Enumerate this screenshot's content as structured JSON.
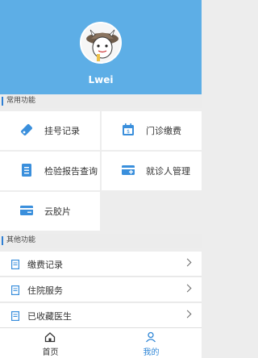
{
  "profile": {
    "username": "Lwei"
  },
  "sections": {
    "common": "常用功能",
    "other": "其他功能"
  },
  "grid": [
    {
      "label": "挂号记录",
      "icon": "registration-icon"
    },
    {
      "label": "门诊缴费",
      "icon": "calendar-payment-icon"
    },
    {
      "label": "检验报告查询",
      "icon": "report-document-icon"
    },
    {
      "label": "就诊人管理",
      "icon": "patient-card-icon"
    },
    {
      "label": "云胶片",
      "icon": "cloud-film-icon"
    }
  ],
  "list": [
    {
      "label": "缴费记录",
      "icon": "document-icon"
    },
    {
      "label": "住院服务",
      "icon": "document-icon"
    },
    {
      "label": "已收藏医生",
      "icon": "document-icon"
    }
  ],
  "tabs": [
    {
      "label": "首页",
      "icon": "home-icon",
      "active": false
    },
    {
      "label": "我的",
      "icon": "profile-icon",
      "active": true
    }
  ],
  "colors": {
    "header": "#5daee6",
    "accent": "#2f7fd3",
    "active_tab": "#2f86d6",
    "inactive_tab": "#333333"
  }
}
